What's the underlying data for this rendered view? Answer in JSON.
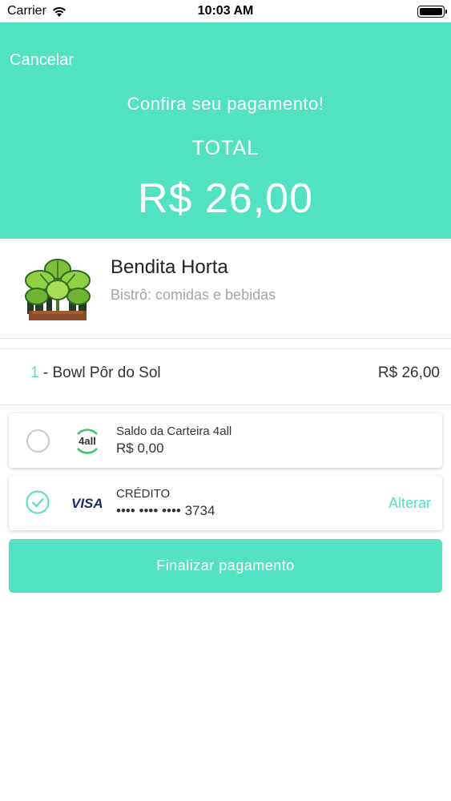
{
  "status_bar": {
    "carrier": "Carrier",
    "time": "10:03 AM"
  },
  "header": {
    "cancel_label": "Cancelar",
    "title": "Confira seu pagamento!",
    "total_label": "TOTAL",
    "total_value": "R$ 26,00",
    "background_color": "#52e2c1"
  },
  "merchant": {
    "name": "Bendita Horta",
    "category": "Bistrô: comidas e bebidas",
    "logo_icon": "plant-logo-icon"
  },
  "order": {
    "items": [
      {
        "quantity": "1",
        "name": " - Bowl Pôr do Sol",
        "price": "R$ 26,00"
      }
    ]
  },
  "payment_methods": [
    {
      "icon": "4all-logo-icon",
      "logo_text": "4all",
      "title": "Saldo da Carteira 4all",
      "value": "R$ 0,00",
      "selected": false
    },
    {
      "icon": "visa-logo-icon",
      "logo_text": "VISA",
      "title": "CRÉDITO",
      "value": "•••• •••• •••• 3734",
      "selected": true,
      "action_label": "Alterar"
    }
  ],
  "finish_button_label": "Finalizar pagamento",
  "accent_color": "#52e2c1"
}
